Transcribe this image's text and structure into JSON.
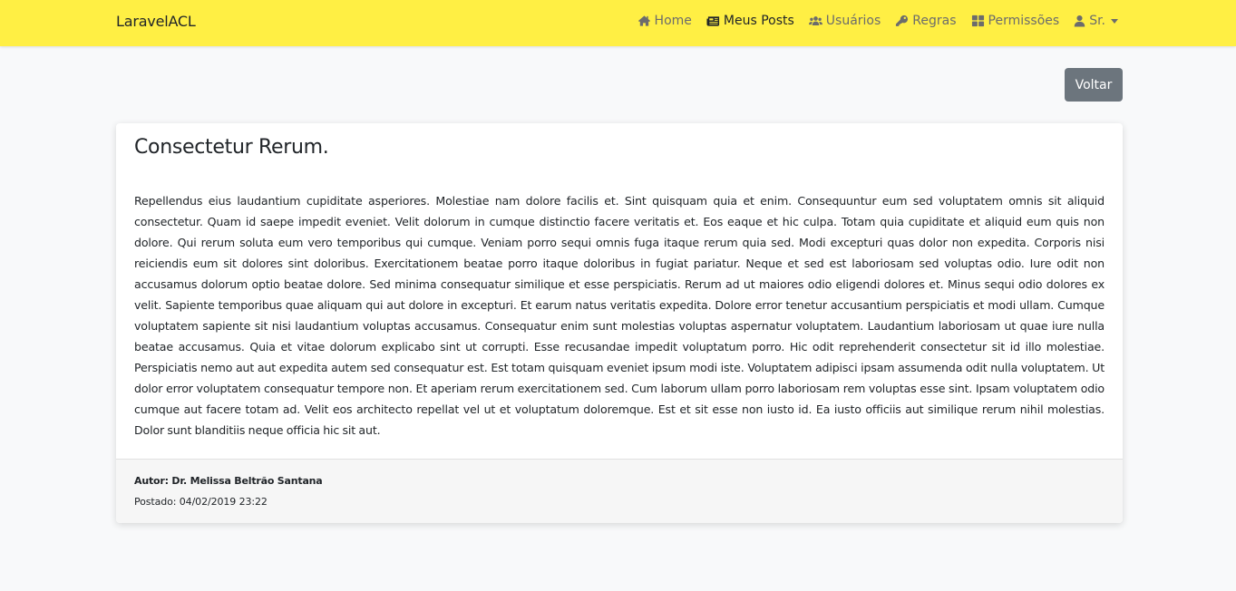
{
  "navbar": {
    "brand": "LaravelACL",
    "items": [
      {
        "label": "Home",
        "icon": "home-icon"
      },
      {
        "label": "Meus Posts",
        "icon": "newspaper-icon",
        "active": true
      },
      {
        "label": "Usuários",
        "icon": "users-icon"
      },
      {
        "label": "Regras",
        "icon": "key-icon"
      },
      {
        "label": "Permissões",
        "icon": "grid-icon"
      },
      {
        "label": "Sr.",
        "icon": "user-icon",
        "dropdown": true
      }
    ],
    "background_color": "#ffef44"
  },
  "actions": {
    "back_label": "Voltar",
    "back_color": "#6c757d"
  },
  "post": {
    "title": "Consectetur Rerum.",
    "body": "Repellendus eius laudantium cupiditate asperiores. Molestiae nam dolore facilis et. Sint quisquam quia et enim. Consequuntur eum sed voluptatem omnis sit aliquid consectetur. Quam id saepe impedit eveniet. Velit dolorum in cumque distinctio facere veritatis et. Eos eaque et hic culpa. Totam quia cupiditate et aliquid eum quis non dolore. Qui rerum soluta eum vero temporibus qui cumque. Veniam porro sequi omnis fuga itaque rerum quia sed. Modi excepturi quas dolor non expedita. Corporis nisi reiciendis eum sit dolores sint doloribus. Exercitationem beatae porro itaque doloribus in fugiat pariatur. Neque et sed est laboriosam sed voluptas odio. Iure odit non accusamus dolorum optio beatae dolore. Sed minima consequatur similique et esse perspiciatis. Rerum ad ut maiores odio eligendi dolores et. Minus sequi odio dolores ex velit. Sapiente temporibus quae aliquam qui aut dolore in excepturi. Et earum natus veritatis expedita. Dolore error tenetur accusantium perspiciatis et modi ullam. Cumque voluptatem sapiente sit nisi laudantium voluptas accusamus. Consequatur enim sunt molestias voluptas aspernatur voluptatem. Laudantium laboriosam ut quae iure nulla beatae accusamus. Quia et vitae dolorum explicabo sint ut corrupti. Esse recusandae impedit voluptatum porro. Hic odit reprehenderit consectetur sit id illo molestiae. Perspiciatis nemo aut aut expedita autem sed consequatur est. Est totam quisquam eveniet ipsum modi iste. Voluptatem adipisci ipsam assumenda odit nulla voluptatem. Ut dolor error voluptatem consequatur tempore non. Et aperiam rerum exercitationem sed. Cum laborum ullam porro laboriosam rem voluptas esse sint. Ipsam voluptatem odio cumque aut facere totam ad. Velit eos architecto repellat vel ut et voluptatum doloremque. Est et sit esse non iusto id. Ea iusto officiis aut similique rerum nihil molestias. Dolor sunt blanditiis neque officia hic sit aut.",
    "author": "Autor: Dr. Melissa Beltrão Santana",
    "posted": "Postado: 04/02/2019 23:22"
  }
}
